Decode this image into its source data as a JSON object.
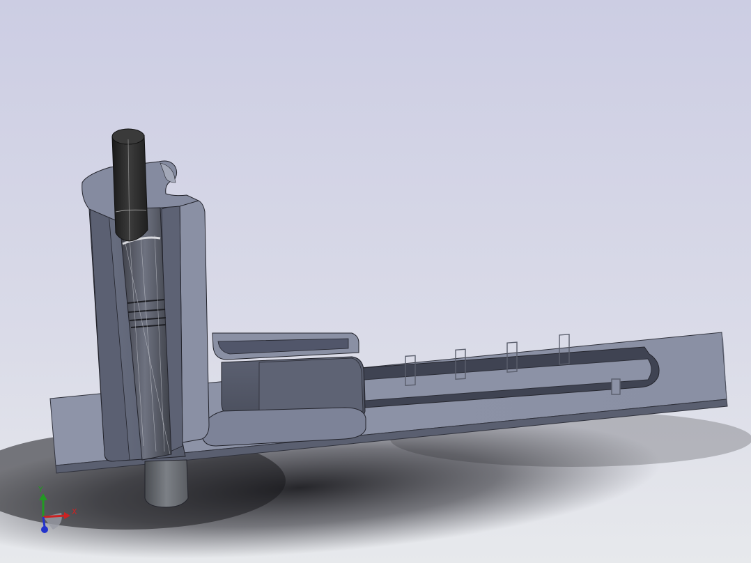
{
  "viewport": {
    "background_top": "#cfcfe4",
    "background_bottom": "#e6e8ec",
    "part_color": "#7f869c",
    "part_dark": "#4d5264",
    "part_light": "#a3a8b8",
    "shaft_color": "#2a2a2a",
    "edge_color": "#22232b"
  },
  "triad": {
    "x_label": "X",
    "y_label": "Y",
    "x_color": "#cc2222",
    "y_color": "#229922",
    "z_color": "#2233cc"
  }
}
